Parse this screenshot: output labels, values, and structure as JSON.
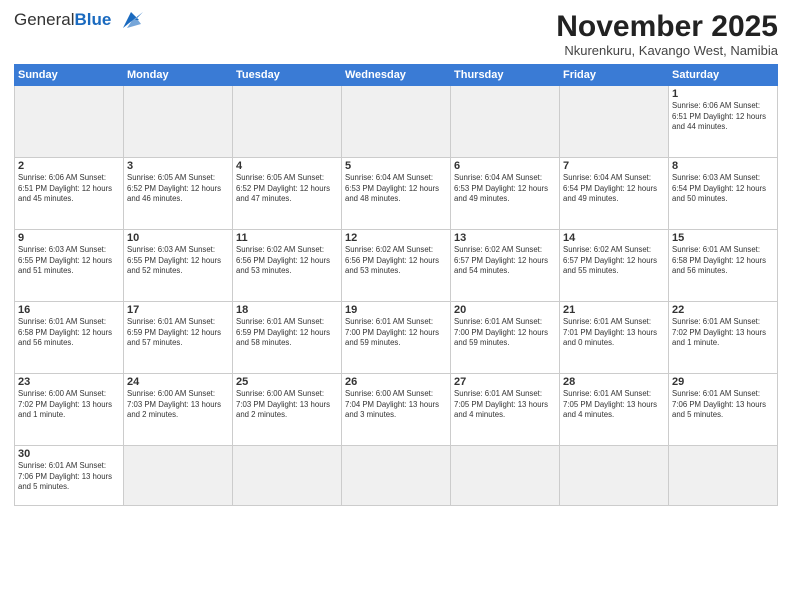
{
  "logo": {
    "general": "General",
    "blue": "Blue"
  },
  "title": "November 2025",
  "subtitle": "Nkurenkuru, Kavango West, Namibia",
  "days_header": [
    "Sunday",
    "Monday",
    "Tuesday",
    "Wednesday",
    "Thursday",
    "Friday",
    "Saturday"
  ],
  "weeks": [
    [
      {
        "num": "",
        "info": ""
      },
      {
        "num": "",
        "info": ""
      },
      {
        "num": "",
        "info": ""
      },
      {
        "num": "",
        "info": ""
      },
      {
        "num": "",
        "info": ""
      },
      {
        "num": "",
        "info": ""
      },
      {
        "num": "1",
        "info": "Sunrise: 6:06 AM\nSunset: 6:51 PM\nDaylight: 12 hours\nand 44 minutes."
      }
    ],
    [
      {
        "num": "2",
        "info": "Sunrise: 6:06 AM\nSunset: 6:51 PM\nDaylight: 12 hours\nand 45 minutes."
      },
      {
        "num": "3",
        "info": "Sunrise: 6:05 AM\nSunset: 6:52 PM\nDaylight: 12 hours\nand 46 minutes."
      },
      {
        "num": "4",
        "info": "Sunrise: 6:05 AM\nSunset: 6:52 PM\nDaylight: 12 hours\nand 47 minutes."
      },
      {
        "num": "5",
        "info": "Sunrise: 6:04 AM\nSunset: 6:53 PM\nDaylight: 12 hours\nand 48 minutes."
      },
      {
        "num": "6",
        "info": "Sunrise: 6:04 AM\nSunset: 6:53 PM\nDaylight: 12 hours\nand 49 minutes."
      },
      {
        "num": "7",
        "info": "Sunrise: 6:04 AM\nSunset: 6:54 PM\nDaylight: 12 hours\nand 49 minutes."
      },
      {
        "num": "8",
        "info": "Sunrise: 6:03 AM\nSunset: 6:54 PM\nDaylight: 12 hours\nand 50 minutes."
      }
    ],
    [
      {
        "num": "9",
        "info": "Sunrise: 6:03 AM\nSunset: 6:55 PM\nDaylight: 12 hours\nand 51 minutes."
      },
      {
        "num": "10",
        "info": "Sunrise: 6:03 AM\nSunset: 6:55 PM\nDaylight: 12 hours\nand 52 minutes."
      },
      {
        "num": "11",
        "info": "Sunrise: 6:02 AM\nSunset: 6:56 PM\nDaylight: 12 hours\nand 53 minutes."
      },
      {
        "num": "12",
        "info": "Sunrise: 6:02 AM\nSunset: 6:56 PM\nDaylight: 12 hours\nand 53 minutes."
      },
      {
        "num": "13",
        "info": "Sunrise: 6:02 AM\nSunset: 6:57 PM\nDaylight: 12 hours\nand 54 minutes."
      },
      {
        "num": "14",
        "info": "Sunrise: 6:02 AM\nSunset: 6:57 PM\nDaylight: 12 hours\nand 55 minutes."
      },
      {
        "num": "15",
        "info": "Sunrise: 6:01 AM\nSunset: 6:58 PM\nDaylight: 12 hours\nand 56 minutes."
      }
    ],
    [
      {
        "num": "16",
        "info": "Sunrise: 6:01 AM\nSunset: 6:58 PM\nDaylight: 12 hours\nand 56 minutes."
      },
      {
        "num": "17",
        "info": "Sunrise: 6:01 AM\nSunset: 6:59 PM\nDaylight: 12 hours\nand 57 minutes."
      },
      {
        "num": "18",
        "info": "Sunrise: 6:01 AM\nSunset: 6:59 PM\nDaylight: 12 hours\nand 58 minutes."
      },
      {
        "num": "19",
        "info": "Sunrise: 6:01 AM\nSunset: 7:00 PM\nDaylight: 12 hours\nand 59 minutes."
      },
      {
        "num": "20",
        "info": "Sunrise: 6:01 AM\nSunset: 7:00 PM\nDaylight: 12 hours\nand 59 minutes."
      },
      {
        "num": "21",
        "info": "Sunrise: 6:01 AM\nSunset: 7:01 PM\nDaylight: 13 hours\nand 0 minutes."
      },
      {
        "num": "22",
        "info": "Sunrise: 6:01 AM\nSunset: 7:02 PM\nDaylight: 13 hours\nand 1 minute."
      }
    ],
    [
      {
        "num": "23",
        "info": "Sunrise: 6:00 AM\nSunset: 7:02 PM\nDaylight: 13 hours\nand 1 minute."
      },
      {
        "num": "24",
        "info": "Sunrise: 6:00 AM\nSunset: 7:03 PM\nDaylight: 13 hours\nand 2 minutes."
      },
      {
        "num": "25",
        "info": "Sunrise: 6:00 AM\nSunset: 7:03 PM\nDaylight: 13 hours\nand 2 minutes."
      },
      {
        "num": "26",
        "info": "Sunrise: 6:00 AM\nSunset: 7:04 PM\nDaylight: 13 hours\nand 3 minutes."
      },
      {
        "num": "27",
        "info": "Sunrise: 6:01 AM\nSunset: 7:05 PM\nDaylight: 13 hours\nand 4 minutes."
      },
      {
        "num": "28",
        "info": "Sunrise: 6:01 AM\nSunset: 7:05 PM\nDaylight: 13 hours\nand 4 minutes."
      },
      {
        "num": "29",
        "info": "Sunrise: 6:01 AM\nSunset: 7:06 PM\nDaylight: 13 hours\nand 5 minutes."
      }
    ],
    [
      {
        "num": "30",
        "info": "Sunrise: 6:01 AM\nSunset: 7:06 PM\nDaylight: 13 hours\nand 5 minutes."
      },
      {
        "num": "",
        "info": ""
      },
      {
        "num": "",
        "info": ""
      },
      {
        "num": "",
        "info": ""
      },
      {
        "num": "",
        "info": ""
      },
      {
        "num": "",
        "info": ""
      },
      {
        "num": "",
        "info": ""
      }
    ]
  ]
}
